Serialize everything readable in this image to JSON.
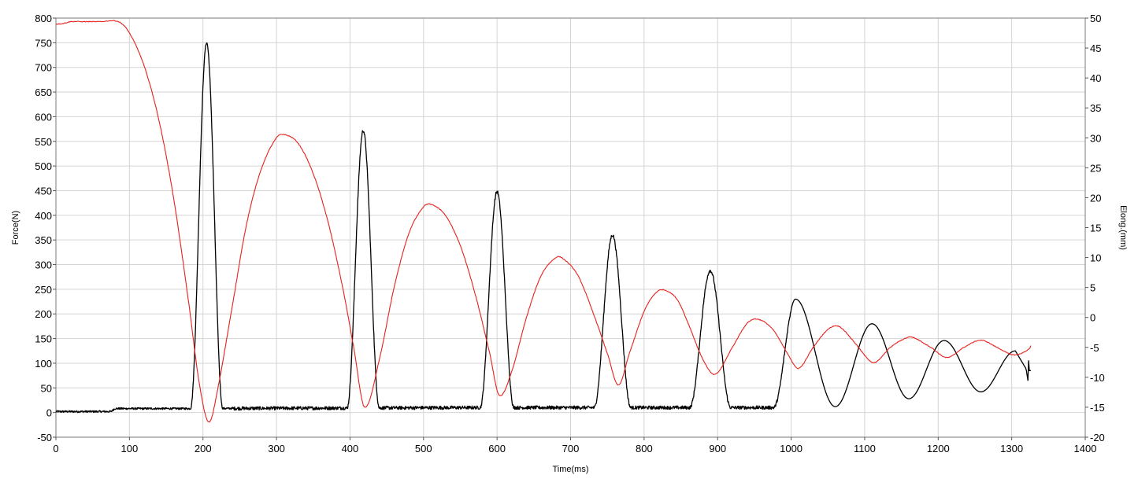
{
  "chart_data": {
    "type": "line",
    "title": "",
    "xlabel": "Time(ms)",
    "ylabel_left": "Force(N)",
    "ylabel_right": "Elong.(mm)",
    "x_ticks": [
      "0",
      "100",
      "200",
      "300",
      "400",
      "500",
      "600",
      "700",
      "800",
      "900",
      "1000",
      "1100",
      "1200",
      "1300",
      "1400"
    ],
    "y_left_ticks": [
      "-50",
      "0",
      "50",
      "100",
      "150",
      "200",
      "250",
      "300",
      "350",
      "400",
      "450",
      "500",
      "550",
      "600",
      "650",
      "700",
      "750",
      "800"
    ],
    "y_right_ticks": [
      "-20",
      "-15",
      "-10",
      "-5",
      "0",
      "5",
      "10",
      "15",
      "20",
      "25",
      "30",
      "35",
      "40",
      "45",
      "50"
    ],
    "xlim": [
      0,
      1400
    ],
    "ylim_left": [
      -50,
      800
    ],
    "ylim_right": [
      -20,
      50
    ],
    "grid": true,
    "colors": {
      "force": "#000000",
      "elongation": "#e8201c",
      "grid": "#d4d4d4"
    },
    "series": [
      {
        "axis": "left",
        "color": "#000000",
        "description": "Force pulses (baseline ~5-10 N between pulses)",
        "baseline": [
          [
            0,
            2
          ],
          [
            75,
            2
          ],
          [
            80,
            8
          ],
          [
            180,
            8
          ],
          [
            555,
            10
          ],
          [
            1000,
            10
          ]
        ],
        "peaks": [
          {
            "t": 205,
            "peak": 750,
            "half_width": 22
          },
          {
            "t": 418,
            "peak": 572,
            "half_width": 22
          },
          {
            "t": 600,
            "peak": 448,
            "half_width": 23
          },
          {
            "t": 757,
            "peak": 360,
            "half_width": 25
          },
          {
            "t": 890,
            "peak": 288,
            "half_width": 28
          },
          {
            "t": 1006,
            "peak": 230,
            "half_width": 30
          },
          {
            "t": 1110,
            "peak": 180,
            "half_width": 32
          },
          {
            "t": 1208,
            "peak": 146,
            "half_width": 33
          },
          {
            "t": 1305,
            "peak": 125,
            "half_width": 34
          }
        ],
        "valleys_between": [
          [
            1060,
            12
          ],
          [
            1160,
            28
          ],
          [
            1258,
            42
          ]
        ],
        "end": [
          [
            1320,
            85
          ],
          [
            1322,
            65
          ],
          [
            1323,
            105
          ],
          [
            1324,
            85
          ],
          [
            1326,
            85
          ]
        ]
      },
      {
        "axis": "right",
        "color": "#e8201c",
        "description": "Elongation oscillation (damped)",
        "points": [
          [
            0,
            49
          ],
          [
            10,
            49.1
          ],
          [
            20,
            49.4
          ],
          [
            40,
            49.4
          ],
          [
            60,
            49.4
          ],
          [
            85,
            49.4
          ],
          [
            100,
            47.5
          ],
          [
            120,
            42
          ],
          [
            140,
            33
          ],
          [
            160,
            20
          ],
          [
            180,
            3
          ],
          [
            195,
            -11
          ],
          [
            208,
            -17.5
          ],
          [
            220,
            -12
          ],
          [
            240,
            2
          ],
          [
            260,
            16
          ],
          [
            280,
            25
          ],
          [
            300,
            30
          ],
          [
            312,
            30.5
          ],
          [
            330,
            29
          ],
          [
            350,
            24
          ],
          [
            370,
            16
          ],
          [
            390,
            5
          ],
          [
            405,
            -5
          ],
          [
            420,
            -15
          ],
          [
            440,
            -7
          ],
          [
            460,
            5
          ],
          [
            480,
            14
          ],
          [
            500,
            18.5
          ],
          [
            512,
            18.8
          ],
          [
            530,
            17
          ],
          [
            550,
            12
          ],
          [
            570,
            4
          ],
          [
            590,
            -6
          ],
          [
            603,
            -13
          ],
          [
            620,
            -9
          ],
          [
            640,
            0
          ],
          [
            660,
            7
          ],
          [
            680,
            10
          ],
          [
            690,
            9.8
          ],
          [
            710,
            7
          ],
          [
            730,
            1
          ],
          [
            750,
            -6
          ],
          [
            765,
            -11.3
          ],
          [
            780,
            -6
          ],
          [
            800,
            1
          ],
          [
            815,
            4
          ],
          [
            827,
            4.6
          ],
          [
            845,
            3
          ],
          [
            860,
            -1
          ],
          [
            880,
            -7
          ],
          [
            897,
            -9.5
          ],
          [
            920,
            -5
          ],
          [
            940,
            -1
          ],
          [
            955,
            -0.3
          ],
          [
            975,
            -2
          ],
          [
            995,
            -6
          ],
          [
            1010,
            -8.5
          ],
          [
            1030,
            -5
          ],
          [
            1050,
            -2
          ],
          [
            1065,
            -1.5
          ],
          [
            1085,
            -4
          ],
          [
            1105,
            -7
          ],
          [
            1115,
            -7.5
          ],
          [
            1135,
            -5
          ],
          [
            1155,
            -3.5
          ],
          [
            1165,
            -3.3
          ],
          [
            1190,
            -5
          ],
          [
            1212,
            -6.7
          ],
          [
            1235,
            -5
          ],
          [
            1258,
            -3.8
          ],
          [
            1280,
            -5
          ],
          [
            1300,
            -6.2
          ],
          [
            1313,
            -6
          ],
          [
            1325,
            -5.1
          ],
          [
            1326,
            -4.7
          ]
        ]
      }
    ]
  }
}
